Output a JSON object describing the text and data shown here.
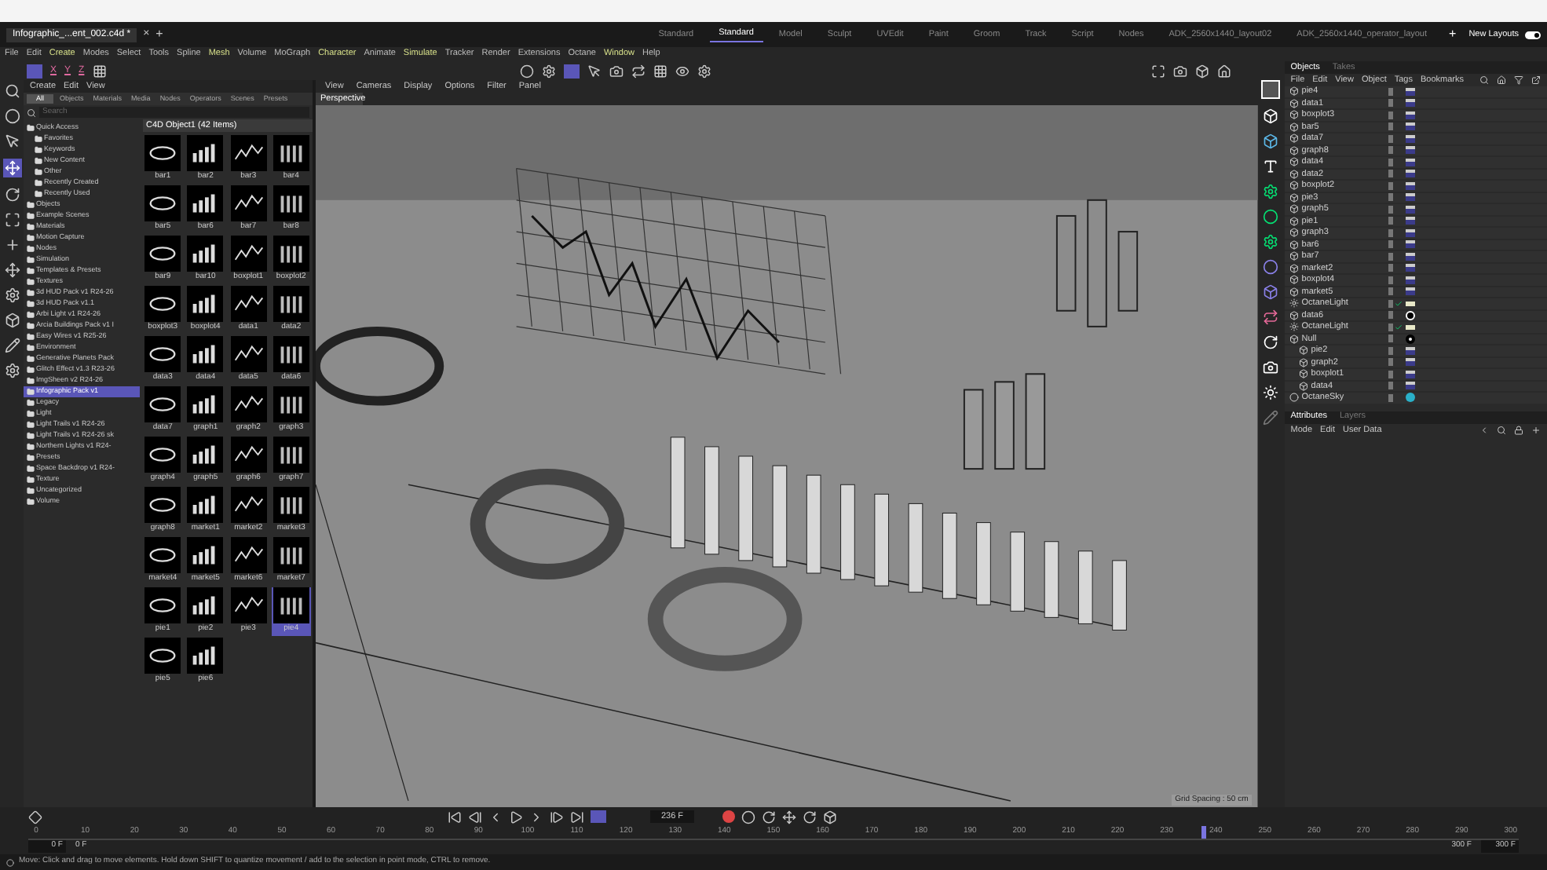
{
  "document_tab": {
    "title": "Infographic_...ent_002.c4d *",
    "close": "×",
    "add": "+"
  },
  "layouts": [
    {
      "label": "Standard",
      "selected": false
    },
    {
      "label": "Standard",
      "selected": true
    },
    {
      "label": "Model",
      "selected": false
    },
    {
      "label": "Sculpt",
      "selected": false
    },
    {
      "label": "UVEdit",
      "selected": false
    },
    {
      "label": "Paint",
      "selected": false
    },
    {
      "label": "Groom",
      "selected": false
    },
    {
      "label": "Track",
      "selected": false
    },
    {
      "label": "Script",
      "selected": false
    },
    {
      "label": "Nodes",
      "selected": false
    },
    {
      "label": "ADK_2560x1440_layout02",
      "selected": false
    },
    {
      "label": "ADK_2560x1440_operator_layout",
      "selected": false
    }
  ],
  "layout_add": "+",
  "new_layouts": "New Layouts",
  "layouts_toggle": {
    "on": true
  },
  "menu": [
    {
      "label": "File",
      "highlighted": false
    },
    {
      "label": "Edit",
      "highlighted": false
    },
    {
      "label": "Create",
      "highlighted": true
    },
    {
      "label": "Modes",
      "highlighted": false
    },
    {
      "label": "Select",
      "highlighted": false
    },
    {
      "label": "Tools",
      "highlighted": false
    },
    {
      "label": "Spline",
      "highlighted": false
    },
    {
      "label": "Mesh",
      "highlighted": true
    },
    {
      "label": "Volume",
      "highlighted": false
    },
    {
      "label": "MoGraph",
      "highlighted": false
    },
    {
      "label": "Character",
      "highlighted": true
    },
    {
      "label": "Animate",
      "highlighted": false
    },
    {
      "label": "Simulate",
      "highlighted": true
    },
    {
      "label": "Tracker",
      "highlighted": false
    },
    {
      "label": "Render",
      "highlighted": false
    },
    {
      "label": "Extensions",
      "highlighted": false
    },
    {
      "label": "Octane",
      "highlighted": false
    },
    {
      "label": "Window",
      "highlighted": true
    },
    {
      "label": "Help",
      "highlighted": false
    }
  ],
  "axis_buttons": [
    "X",
    "Y",
    "Z"
  ],
  "asset_browser": {
    "menu": [
      "Create",
      "Edit",
      "View"
    ],
    "tabs": [
      {
        "label": "All",
        "selected": true
      },
      {
        "label": "Objects",
        "selected": false
      },
      {
        "label": "Materials",
        "selected": false
      },
      {
        "label": "Media",
        "selected": false
      },
      {
        "label": "Nodes",
        "selected": false
      },
      {
        "label": "Operators",
        "selected": false
      },
      {
        "label": "Scenes",
        "selected": false
      },
      {
        "label": "Presets",
        "selected": false
      }
    ],
    "search": {
      "placeholder": "Search"
    },
    "tree": [
      {
        "label": "Quick Access",
        "selected": false,
        "children": [
          {
            "label": "Favorites",
            "selected": false
          },
          {
            "label": "Keywords",
            "selected": false
          },
          {
            "label": "New Content",
            "selected": false
          },
          {
            "label": "Other",
            "selected": false
          },
          {
            "label": "Recently Created",
            "selected": false
          },
          {
            "label": "Recently Used",
            "selected": false
          }
        ]
      },
      {
        "label": "Objects",
        "selected": false
      },
      {
        "label": "Example Scenes",
        "selected": false
      },
      {
        "label": "Materials",
        "selected": false
      },
      {
        "label": "Motion Capture",
        "selected": false
      },
      {
        "label": "Nodes",
        "selected": false
      },
      {
        "label": "Simulation",
        "selected": false
      },
      {
        "label": "Templates & Presets",
        "selected": false
      },
      {
        "label": "Textures",
        "selected": false
      },
      {
        "label": "3d HUD Pack v1 R24-26",
        "selected": false
      },
      {
        "label": "3d HUD Pack v1.1",
        "selected": false
      },
      {
        "label": "Arbi Light v1 R24-26",
        "selected": false
      },
      {
        "label": "Arcia Buildings Pack v1 I",
        "selected": false
      },
      {
        "label": "Easy Wires v1 R25-26",
        "selected": false
      },
      {
        "label": "Environment",
        "selected": false
      },
      {
        "label": "Generative Planets Pack",
        "selected": false
      },
      {
        "label": "Glitch Effect v1.3 R23-26",
        "selected": false
      },
      {
        "label": "ImgSheen v2 R24-26",
        "selected": false
      },
      {
        "label": "Infographic Pack v1",
        "selected": true
      },
      {
        "label": "Legacy",
        "selected": false
      },
      {
        "label": "Light",
        "selected": false
      },
      {
        "label": "Light Trails v1 R24-26",
        "selected": false
      },
      {
        "label": "Light Trails v1 R24-26 sk",
        "selected": false
      },
      {
        "label": "Northern Lights v1 R24-",
        "selected": false
      },
      {
        "label": "Presets",
        "selected": false
      },
      {
        "label": "Space Backdrop v1 R24-",
        "selected": false
      },
      {
        "label": "Texture",
        "selected": false
      },
      {
        "label": "Uncategorized",
        "selected": false
      },
      {
        "label": "Volume",
        "selected": false
      }
    ],
    "grid_title": "C4D Object1 (42 Items)",
    "assets": [
      {
        "label": "bar1",
        "selected": false
      },
      {
        "label": "bar2",
        "selected": false
      },
      {
        "label": "bar3",
        "selected": false
      },
      {
        "label": "bar4",
        "selected": false
      },
      {
        "label": "bar5",
        "selected": false
      },
      {
        "label": "bar6",
        "selected": false
      },
      {
        "label": "bar7",
        "selected": false
      },
      {
        "label": "bar8",
        "selected": false
      },
      {
        "label": "bar9",
        "selected": false
      },
      {
        "label": "bar10",
        "selected": false
      },
      {
        "label": "boxplot1",
        "selected": false
      },
      {
        "label": "boxplot2",
        "selected": false
      },
      {
        "label": "boxplot3",
        "selected": false
      },
      {
        "label": "boxplot4",
        "selected": false
      },
      {
        "label": "data1",
        "selected": false
      },
      {
        "label": "data2",
        "selected": false
      },
      {
        "label": "data3",
        "selected": false
      },
      {
        "label": "data4",
        "selected": false
      },
      {
        "label": "data5",
        "selected": false
      },
      {
        "label": "data6",
        "selected": false
      },
      {
        "label": "data7",
        "selected": false
      },
      {
        "label": "graph1",
        "selected": false
      },
      {
        "label": "graph2",
        "selected": false
      },
      {
        "label": "graph3",
        "selected": false
      },
      {
        "label": "graph4",
        "selected": false
      },
      {
        "label": "graph5",
        "selected": false
      },
      {
        "label": "graph6",
        "selected": false
      },
      {
        "label": "graph7",
        "selected": false
      },
      {
        "label": "graph8",
        "selected": false
      },
      {
        "label": "market1",
        "selected": false
      },
      {
        "label": "market2",
        "selected": false
      },
      {
        "label": "market3",
        "selected": false
      },
      {
        "label": "market4",
        "selected": false
      },
      {
        "label": "market5",
        "selected": false
      },
      {
        "label": "market6",
        "selected": false
      },
      {
        "label": "market7",
        "selected": false
      },
      {
        "label": "pie1",
        "selected": false
      },
      {
        "label": "pie2",
        "selected": false
      },
      {
        "label": "pie3",
        "selected": false
      },
      {
        "label": "pie4",
        "selected": true
      },
      {
        "label": "pie5",
        "selected": false
      },
      {
        "label": "pie6",
        "selected": false
      }
    ]
  },
  "viewport": {
    "menu": [
      "View",
      "Cameras",
      "Display",
      "Options",
      "Filter",
      "Panel"
    ],
    "tab": "Perspective",
    "grid_spacing": "Grid Spacing : 50 cm"
  },
  "object_manager": {
    "tabs": [
      {
        "label": "Objects",
        "selected": true
      },
      {
        "label": "Takes",
        "selected": false
      }
    ],
    "menu": [
      "File",
      "Edit",
      "View",
      "Object",
      "Tags",
      "Bookmarks"
    ],
    "objects": [
      {
        "name": "pie4",
        "kind": "object"
      },
      {
        "name": "data1",
        "kind": "object"
      },
      {
        "name": "boxplot3",
        "kind": "object"
      },
      {
        "name": "bar5",
        "kind": "object"
      },
      {
        "name": "data7",
        "kind": "object"
      },
      {
        "name": "graph8",
        "kind": "object"
      },
      {
        "name": "data4",
        "kind": "object"
      },
      {
        "name": "data2",
        "kind": "object"
      },
      {
        "name": "boxplot2",
        "kind": "object"
      },
      {
        "name": "pie3",
        "kind": "object"
      },
      {
        "name": "graph5",
        "kind": "object"
      },
      {
        "name": "pie1",
        "kind": "object"
      },
      {
        "name": "graph3",
        "kind": "object"
      },
      {
        "name": "bar6",
        "kind": "object"
      },
      {
        "name": "bar7",
        "kind": "object"
      },
      {
        "name": "market2",
        "kind": "object"
      },
      {
        "name": "boxplot4",
        "kind": "object"
      },
      {
        "name": "market5",
        "kind": "object"
      },
      {
        "name": "OctaneLight",
        "kind": "light"
      },
      {
        "name": "data6",
        "kind": "material"
      },
      {
        "name": "OctaneLight",
        "kind": "light"
      },
      {
        "name": "Null",
        "kind": "null",
        "children": [
          {
            "name": "pie2",
            "kind": "object"
          },
          {
            "name": "graph2",
            "kind": "object"
          },
          {
            "name": "boxplot1",
            "kind": "object"
          },
          {
            "name": "data4",
            "kind": "object"
          }
        ]
      },
      {
        "name": "OctaneSky",
        "kind": "sky"
      }
    ]
  },
  "attributes": {
    "tabs": [
      {
        "label": "Attributes",
        "selected": true
      },
      {
        "label": "Layers",
        "selected": false
      }
    ],
    "menu": [
      "Mode",
      "Edit",
      "User Data"
    ]
  },
  "timeline": {
    "frame": "236 F",
    "level": 0.787,
    "ticks": [
      "0",
      "10",
      "20",
      "30",
      "40",
      "50",
      "60",
      "70",
      "80",
      "90",
      "100",
      "110",
      "120",
      "130",
      "140",
      "150",
      "160",
      "170",
      "180",
      "190",
      "200",
      "210",
      "220",
      "230",
      "240",
      "250",
      "260",
      "270",
      "280",
      "290",
      "300"
    ],
    "start": "0 F",
    "start_preview": "0 F",
    "end_preview": "300 F",
    "end": "300 F"
  },
  "status": "Move: Click and drag to move elements. Hold down SHIFT to quantize movement / add to the selection in point mode, CTRL to remove."
}
